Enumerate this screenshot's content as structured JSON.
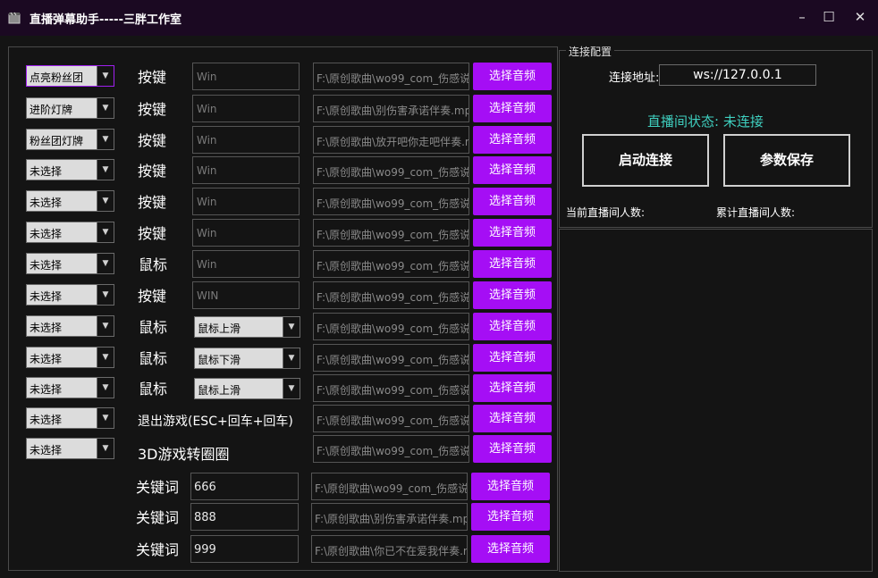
{
  "window": {
    "title": "直播弹幕助手-----三胖工作室",
    "app_icon": "film-reel-icon",
    "minimize_icon": "–",
    "maximize_icon": "☐",
    "close_icon": "✕"
  },
  "rows": [
    {
      "event": "点亮粉丝团",
      "mode": "按键",
      "input_type": "text",
      "key": "Win",
      "path": "F:\\原创歌曲\\wo99_com_伤感说",
      "button": "选择音频"
    },
    {
      "event": "进阶灯牌",
      "mode": "按键",
      "input_type": "text",
      "key": "Win",
      "path": "F:\\原创歌曲\\别伤害承诺伴奏.mp",
      "button": "选择音频"
    },
    {
      "event": "粉丝团灯牌",
      "mode": "按键",
      "input_type": "text",
      "key": "Win",
      "path": "F:\\原创歌曲\\放开吧你走吧伴奏.n",
      "button": "选择音频"
    },
    {
      "event": "未选择",
      "mode": "按键",
      "input_type": "text",
      "key": "Win",
      "path": "F:\\原创歌曲\\wo99_com_伤感说",
      "button": "选择音频"
    },
    {
      "event": "未选择",
      "mode": "按键",
      "input_type": "text",
      "key": "Win",
      "path": "F:\\原创歌曲\\wo99_com_伤感说",
      "button": "选择音频"
    },
    {
      "event": "未选择",
      "mode": "按键",
      "input_type": "text",
      "key": "Win",
      "path": "F:\\原创歌曲\\wo99_com_伤感说",
      "button": "选择音频"
    },
    {
      "event": "未选择",
      "mode": "鼠标",
      "input_type": "text",
      "key": "Win",
      "path": "F:\\原创歌曲\\wo99_com_伤感说",
      "button": "选择音频"
    },
    {
      "event": "未选择",
      "mode": "按键",
      "input_type": "text",
      "key": "WIN",
      "path": "F:\\原创歌曲\\wo99_com_伤感说",
      "button": "选择音频"
    },
    {
      "event": "未选择",
      "mode": "鼠标",
      "input_type": "select",
      "key": "鼠标上滑",
      "path": "F:\\原创歌曲\\wo99_com_伤感说",
      "button": "选择音频"
    },
    {
      "event": "未选择",
      "mode": "鼠标",
      "input_type": "select",
      "key": "鼠标下滑",
      "path": "F:\\原创歌曲\\wo99_com_伤感说",
      "button": "选择音频"
    },
    {
      "event": "未选择",
      "mode": "鼠标",
      "input_type": "select",
      "key": "鼠标上滑",
      "path": "F:\\原创歌曲\\wo99_com_伤感说",
      "button": "选择音频"
    },
    {
      "event": "未选择",
      "mode": "退出游戏(ESC+回车+回车)",
      "input_type": "none",
      "key": "",
      "path": "F:\\原创歌曲\\wo99_com_伤感说",
      "button": "选择音频"
    },
    {
      "event": "未选择",
      "mode": "3D游戏转圈圈",
      "input_type": "none",
      "key": "",
      "path": "F:\\原创歌曲\\wo99_com_伤感说",
      "button": "选择音频"
    }
  ],
  "keyword_rows": [
    {
      "label": "关键词",
      "value": "666",
      "path": "F:\\原创歌曲\\wo99_com_伤感说",
      "button": "选择音频"
    },
    {
      "label": "关键词",
      "value": "888",
      "path": "F:\\原创歌曲\\别伤害承诺伴奏.mp",
      "button": "选择音频"
    },
    {
      "label": "关键词",
      "value": "999",
      "path": "F:\\原创歌曲\\你已不在爱我伴奏.n",
      "button": "选择音频"
    }
  ],
  "connection": {
    "group_title": "连接配置",
    "address_label": "连接地址:",
    "address_value": "ws://127.0.0.1",
    "status": "直播间状态: 未连接",
    "start_button": "启动连接",
    "save_button": "参数保存",
    "current_viewers_label": "当前直播间人数:",
    "total_viewers_label": "累计直播间人数:"
  },
  "colors": {
    "accent": "#a50ef5",
    "status": "#3fd0c0",
    "titlebar": "#1b0922",
    "background": "#141414"
  }
}
